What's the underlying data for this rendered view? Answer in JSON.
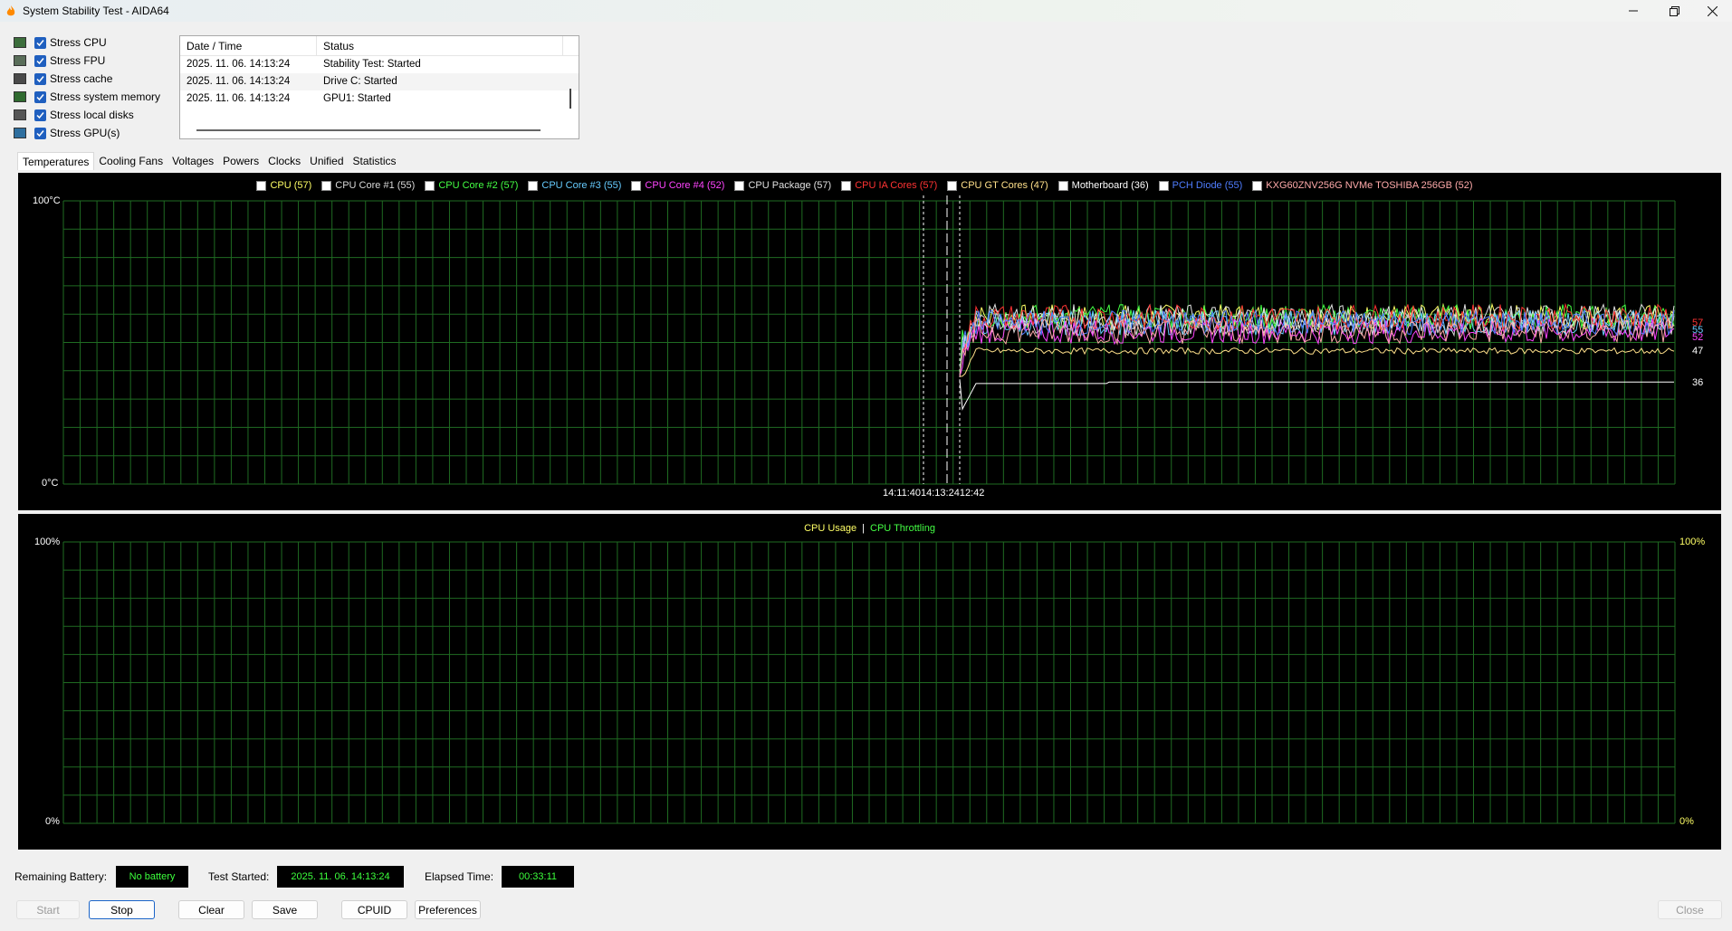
{
  "window": {
    "title": "System Stability Test - AIDA64"
  },
  "stress": [
    {
      "label": "Stress CPU",
      "icon": "cpu-icon"
    },
    {
      "label": "Stress FPU",
      "icon": "fpu-icon"
    },
    {
      "label": "Stress cache",
      "icon": "cache-icon"
    },
    {
      "label": "Stress system memory",
      "icon": "memory-icon"
    },
    {
      "label": "Stress local disks",
      "icon": "disk-icon"
    },
    {
      "label": "Stress GPU(s)",
      "icon": "gpu-icon"
    }
  ],
  "log": {
    "headers": [
      "Date / Time",
      "Status"
    ],
    "rows": [
      [
        "2025. 11. 06. 14:13:24",
        "Stability Test: Started"
      ],
      [
        "2025. 11. 06. 14:13:24",
        "Drive C: Started"
      ],
      [
        "2025. 11. 06. 14:13:24",
        "GPU1: Started"
      ]
    ]
  },
  "tabs": [
    "Temperatures",
    "Cooling Fans",
    "Voltages",
    "Powers",
    "Clocks",
    "Unified",
    "Statistics"
  ],
  "temp_graph": {
    "legend": [
      {
        "label": "CPU (57)",
        "color": "#ffff66"
      },
      {
        "label": "CPU Core #1 (55)",
        "color": "#d8d8d8"
      },
      {
        "label": "CPU Core #2 (57)",
        "color": "#44ff44"
      },
      {
        "label": "CPU Core #3 (55)",
        "color": "#66ccff"
      },
      {
        "label": "CPU Core #4 (52)",
        "color": "#ff44ff"
      },
      {
        "label": "CPU Package (57)",
        "color": "#e0e0e0"
      },
      {
        "label": "CPU IA Cores (57)",
        "color": "#ff3333"
      },
      {
        "label": "CPU GT Cores (47)",
        "color": "#ffe08a"
      },
      {
        "label": "Motherboard (36)",
        "color": "#ffffff"
      },
      {
        "label": "PCH Diode (55)",
        "color": "#4f7dff"
      },
      {
        "label": "KXG60ZNV256G NVMe TOSHIBA 256GB (52)",
        "color": "#ffaaaa"
      }
    ],
    "y_top": "100°C",
    "y_bottom": "0°C",
    "time_label": "14:11:4014:13:2412:42",
    "right_values": [
      "57",
      "55",
      "52",
      "47",
      "36"
    ]
  },
  "usage_graph": {
    "legend_usage": "CPU Usage",
    "separator": "|",
    "legend_throttle": "CPU Throttling",
    "y_top_left": "100%",
    "y_bottom_left": "0%",
    "y_top_right": "100%",
    "y_bottom_right": "0%"
  },
  "status": {
    "battery_label": "Remaining Battery:",
    "battery_value": "No battery",
    "started_label": "Test Started:",
    "started_value": "2025. 11. 06. 14:13:24",
    "elapsed_label": "Elapsed Time:",
    "elapsed_value": "00:33:11"
  },
  "buttons": {
    "start": "Start",
    "stop": "Stop",
    "clear": "Clear",
    "save": "Save",
    "cpuid": "CPUID",
    "preferences": "Preferences",
    "close": "Close"
  },
  "chart_data": {
    "type": "line",
    "y_range": [
      0,
      100
    ],
    "ylabel": "°C",
    "series_final": [
      {
        "name": "CPU",
        "value": 57
      },
      {
        "name": "CPU Core #1",
        "value": 55
      },
      {
        "name": "CPU Core #2",
        "value": 57
      },
      {
        "name": "CPU Core #3",
        "value": 55
      },
      {
        "name": "CPU Core #4",
        "value": 52
      },
      {
        "name": "CPU Package",
        "value": 57
      },
      {
        "name": "CPU IA Cores",
        "value": 57
      },
      {
        "name": "CPU GT Cores",
        "value": 47
      },
      {
        "name": "Motherboard",
        "value": 36
      },
      {
        "name": "PCH Diode",
        "value": 55
      },
      {
        "name": "KXG60ZNV256G NVMe TOSHIBA 256GB",
        "value": 52
      }
    ]
  }
}
